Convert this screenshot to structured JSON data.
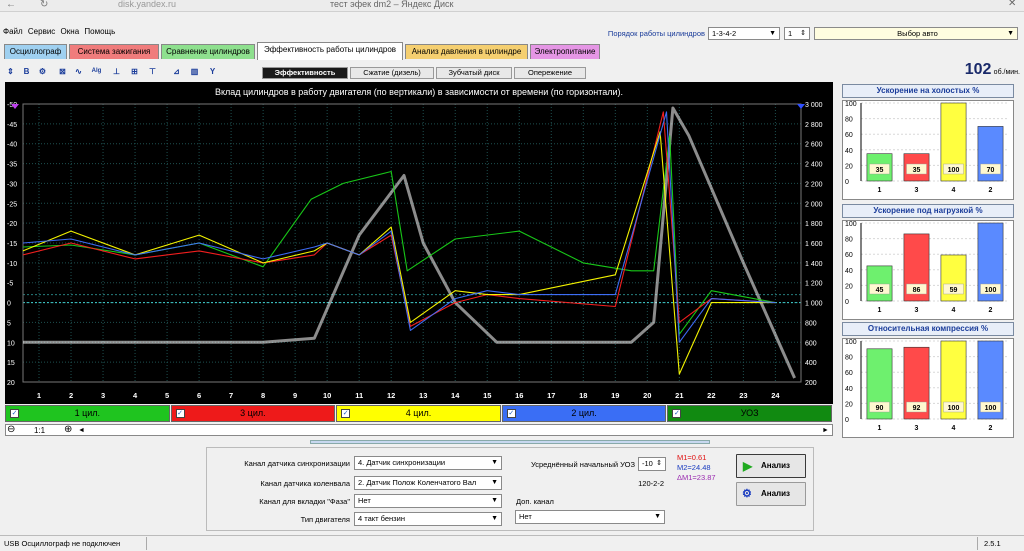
{
  "browser": {
    "tab_title": "тест эфек dm2 – Яндекс Диск",
    "address": "disk.yandex.ru"
  },
  "menu": [
    "Файл",
    "Сервис",
    "Окна",
    "Помощь"
  ],
  "order": {
    "label": "Порядок работы цилиндров",
    "value": "1-3-4-2",
    "spin": "1",
    "car": "Выбор авто"
  },
  "tabs": [
    {
      "label": "Осциллограф",
      "color": "#9fd0f0"
    },
    {
      "label": "Система зажигания",
      "color": "#f07c7c"
    },
    {
      "label": "Сравнение цилиндров",
      "color": "#8ee08e"
    },
    {
      "label": "Эффективность работы цилиндров",
      "color": "#ffffff"
    },
    {
      "label": "Анализ давления в цилиндре",
      "color": "#f5cf70"
    },
    {
      "label": "Электропитание",
      "color": "#e596e5"
    }
  ],
  "subtabs": [
    "Эффективность",
    "Сжатие (дизель)",
    "Зубчатый диск",
    "Опережение"
  ],
  "rpm": {
    "value": "102",
    "unit": "об./мин."
  },
  "chart": {
    "title": "Вклад цилиндров в работу двигателя (по вертикали) в зависимости от времени (по горизонтали)."
  },
  "chart_data": {
    "type": "line",
    "left_ticks": [
      "-50",
      "-45",
      "-40",
      "-35",
      "-30",
      "-25",
      "-20",
      "-15",
      "-10",
      "-5",
      "0",
      "5",
      "10",
      "15",
      "20"
    ],
    "right_ticks": [
      "3 000",
      "2 800",
      "2 600",
      "2 400",
      "2 200",
      "2 000",
      "1 800",
      "1 600",
      "1 400",
      "1 200",
      "1 000",
      "800",
      "600",
      "400",
      "200"
    ],
    "x_ticks": [
      "1",
      "2",
      "3",
      "4",
      "5",
      "6",
      "7",
      "8",
      "9",
      "10",
      "11",
      "12",
      "13",
      "14",
      "15",
      "16",
      "17",
      "18",
      "19",
      "20",
      "21",
      "22",
      "23",
      "24"
    ],
    "xlim": [
      0.5,
      24.8
    ],
    "ylim_left": [
      -50,
      20
    ],
    "ylim_right": [
      3100,
      100
    ],
    "series": [
      {
        "color": "#ffffff",
        "values": [
          [
            0.5,
            10
          ],
          [
            5,
            10
          ],
          [
            8,
            10
          ],
          [
            9.6,
            9
          ],
          [
            11,
            -17
          ],
          [
            12.4,
            -32
          ],
          [
            13,
            -15
          ],
          [
            14,
            0
          ],
          [
            15.3,
            10
          ],
          [
            19.5,
            10
          ],
          [
            20.2,
            5
          ],
          [
            20.8,
            -49
          ],
          [
            21.3,
            -42
          ],
          [
            23,
            -10
          ],
          [
            24.6,
            19
          ]
        ]
      },
      {
        "color": "#19d219",
        "values": [
          [
            0.5,
            -14
          ],
          [
            2,
            -14.5
          ],
          [
            4,
            -12
          ],
          [
            6,
            -15
          ],
          [
            8,
            -9
          ],
          [
            9.5,
            -26
          ],
          [
            10.5,
            -30
          ],
          [
            12,
            -33
          ],
          [
            12.5,
            -8
          ],
          [
            14,
            -16
          ],
          [
            16,
            -18
          ],
          [
            18,
            -10
          ],
          [
            19.5,
            -8
          ],
          [
            20.2,
            -8
          ],
          [
            20.7,
            -42
          ],
          [
            21,
            8
          ],
          [
            22,
            -3
          ],
          [
            24,
            0
          ]
        ]
      },
      {
        "color": "#ff2020",
        "values": [
          [
            0.5,
            -12
          ],
          [
            2,
            -15
          ],
          [
            4,
            -11
          ],
          [
            6,
            -13
          ],
          [
            8,
            -10
          ],
          [
            9.6,
            -12
          ],
          [
            10,
            -15
          ],
          [
            11,
            -12
          ],
          [
            12,
            -17
          ],
          [
            12.6,
            6
          ],
          [
            14,
            0
          ],
          [
            15,
            -2
          ],
          [
            16,
            -1
          ],
          [
            19,
            1
          ],
          [
            20.5,
            -48
          ],
          [
            21,
            5
          ],
          [
            22,
            -1
          ],
          [
            24,
            0
          ]
        ]
      },
      {
        "color": "#ffff00",
        "values": [
          [
            0.5,
            -13
          ],
          [
            2,
            -18
          ],
          [
            4,
            -12
          ],
          [
            6,
            -17
          ],
          [
            8,
            -10
          ],
          [
            9.6,
            -13
          ],
          [
            10,
            -15
          ],
          [
            11,
            -12
          ],
          [
            12,
            -19
          ],
          [
            12.6,
            5
          ],
          [
            14,
            -3
          ],
          [
            15,
            -2
          ],
          [
            16,
            -2
          ],
          [
            19,
            -7
          ],
          [
            20.4,
            -43
          ],
          [
            21,
            18
          ],
          [
            22,
            0
          ],
          [
            24,
            0
          ]
        ]
      },
      {
        "color": "#4070ff",
        "values": [
          [
            0.5,
            -15
          ],
          [
            2,
            -16
          ],
          [
            4,
            -12
          ],
          [
            6,
            -15
          ],
          [
            8,
            -11
          ],
          [
            9.6,
            -14
          ],
          [
            10,
            -15
          ],
          [
            11,
            -12
          ],
          [
            12,
            -18
          ],
          [
            12.6,
            7
          ],
          [
            14,
            -1
          ],
          [
            15,
            -3
          ],
          [
            16,
            -2
          ],
          [
            19,
            -2
          ],
          [
            20.6,
            -48
          ],
          [
            21,
            10
          ],
          [
            22,
            -1
          ],
          [
            24,
            0
          ]
        ]
      }
    ]
  },
  "channels": [
    {
      "label": "1 цил.",
      "bg": "#1fc41f",
      "color": "#000"
    },
    {
      "label": "3 цил.",
      "bg": "#ee1a1a",
      "color": "#000"
    },
    {
      "label": "4 цил.",
      "bg": "#ffff00",
      "color": "#000"
    },
    {
      "label": "2 цил.",
      "bg": "#3a6ef5",
      "color": "#000"
    },
    {
      "label": "УОЗ",
      "bg": "#118a11",
      "color": "#000"
    }
  ],
  "zoom": "1:1",
  "panels": [
    {
      "title": "Ускорение на холостых %",
      "bars": [
        35,
        35,
        100,
        70
      ],
      "labels": [
        "35",
        "35",
        "100",
        "70"
      ]
    },
    {
      "title": "Ускорение под нагрузкой %",
      "bars": [
        45,
        86,
        59,
        100
      ],
      "labels": [
        "45",
        "86",
        "59",
        "100"
      ]
    },
    {
      "title": "Относительная компрессия %",
      "bars": [
        90,
        92,
        100,
        100
      ],
      "labels": [
        "90",
        "92",
        "100",
        "100"
      ]
    }
  ],
  "panel_axis": [
    "100",
    "80",
    "60",
    "40",
    "20",
    "0"
  ],
  "panel_cats": [
    "1",
    "3",
    "4",
    "2"
  ],
  "panel_colors": [
    "#6ef06e",
    "#ff4a4a",
    "#ffff40",
    "#5a8aff"
  ],
  "settings": {
    "sync_label": "Канал датчика синхронизации",
    "sync_value": "4. Датчик синхронизации",
    "crank_label": "Канал датчика коленвала",
    "crank_value": "2. Датчик Полож Коленчатого Вал",
    "phase_label": "Канал для вкладки \"Фаза\"",
    "phase_value": "Нет",
    "engine_label": "Тип двигателя",
    "engine_value": "4 такт бензин",
    "uoz_label": "Усреднённый начальный УОЗ",
    "uoz_value": "-10",
    "uoz_code": "120-2-2",
    "extra_label": "Доп. канал",
    "extra_value": "Нет",
    "m1": "M1=0.61",
    "m2": "M2=24.48",
    "dm": "ΔM1=23.87",
    "analyze1": "Анализ",
    "analyze2": "Анализ"
  },
  "status": {
    "left": "USB Осциллограф не подключен",
    "version": "2.5.1"
  }
}
